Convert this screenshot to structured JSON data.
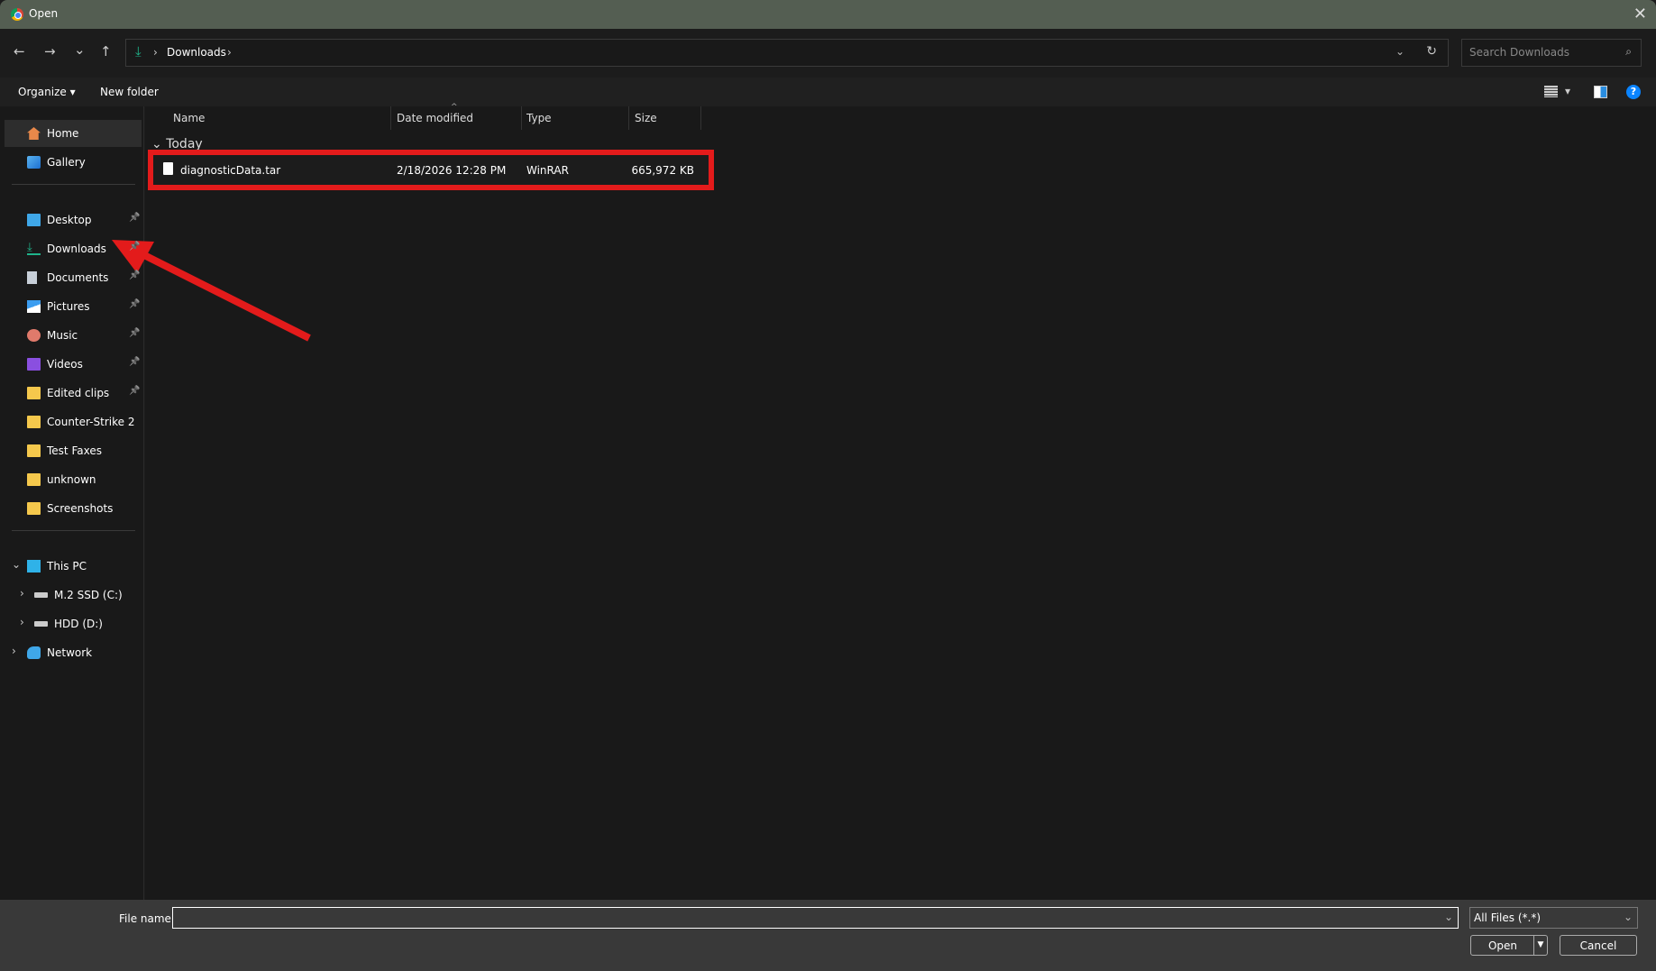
{
  "window": {
    "title": "Open",
    "close_icon": "close-icon"
  },
  "nav": {
    "back": "←",
    "forward": "→",
    "recent": "⌄",
    "up": "↑"
  },
  "address": {
    "crumbs": [
      "Downloads"
    ],
    "separator": "›"
  },
  "search": {
    "placeholder": "Search Downloads"
  },
  "toolbar": {
    "organize": "Organize",
    "new_folder": "New folder"
  },
  "sidebar": {
    "items": [
      {
        "label": "Home",
        "icon": "home-icon",
        "selected": true
      },
      {
        "label": "Gallery",
        "icon": "gallery-icon"
      },
      {
        "label": "Desktop",
        "icon": "desktop-icon",
        "pinned": true
      },
      {
        "label": "Downloads",
        "icon": "download-icon",
        "pinned": true
      },
      {
        "label": "Documents",
        "icon": "documents-icon",
        "pinned": true
      },
      {
        "label": "Pictures",
        "icon": "pictures-icon",
        "pinned": true
      },
      {
        "label": "Music",
        "icon": "music-icon",
        "pinned": true
      },
      {
        "label": "Videos",
        "icon": "videos-icon",
        "pinned": true
      },
      {
        "label": "Edited clips",
        "icon": "folder-icon",
        "pinned": true
      },
      {
        "label": "Counter-Strike 2",
        "icon": "folder-icon"
      },
      {
        "label": "Test Faxes",
        "icon": "folder-icon"
      },
      {
        "label": "unknown",
        "icon": "folder-icon"
      },
      {
        "label": "Screenshots",
        "icon": "folder-icon"
      },
      {
        "label": "This PC",
        "icon": "pc-icon",
        "expanded": true
      },
      {
        "label": "M.2 SSD (C:)",
        "icon": "drive-icon"
      },
      {
        "label": "HDD (D:)",
        "icon": "drive-icon"
      },
      {
        "label": "Network",
        "icon": "network-icon"
      }
    ]
  },
  "columns": {
    "name": "Name",
    "date": "Date modified",
    "type": "Type",
    "size": "Size"
  },
  "groups": [
    {
      "label": "Today",
      "files": [
        {
          "name": "diagnosticData.tar",
          "date": "2/18/2026 12:28 PM",
          "type": "WinRAR",
          "size": "665,972 KB"
        }
      ]
    }
  ],
  "footer": {
    "file_name_label": "File name:",
    "file_name_value": "",
    "filter": "All Files (*.*)",
    "open": "Open",
    "cancel": "Cancel"
  },
  "annotation": {
    "color": "#e31b1b"
  },
  "colors": {
    "accent_download": "#1fb38a",
    "help": "#0a84ff"
  }
}
